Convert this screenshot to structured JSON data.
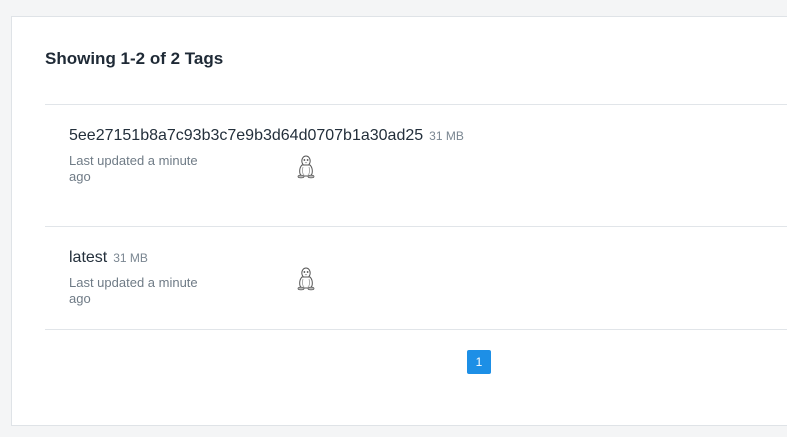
{
  "heading": "Showing 1-2 of 2 Tags",
  "tags": [
    {
      "name": "5ee27151b8a7c93b3c7e9b3d64d0707b1a30ad25",
      "size": "31 MB",
      "updated": "Last updated a minute ago",
      "os_icon": "linux-tux-icon"
    },
    {
      "name": "latest",
      "size": "31 MB",
      "updated": "Last updated a minute ago",
      "os_icon": "linux-tux-icon"
    }
  ],
  "pagination": {
    "current_page": "1"
  },
  "colors": {
    "accent": "#1d8fe6",
    "background": "#f4f5f6",
    "panel": "#ffffff"
  }
}
